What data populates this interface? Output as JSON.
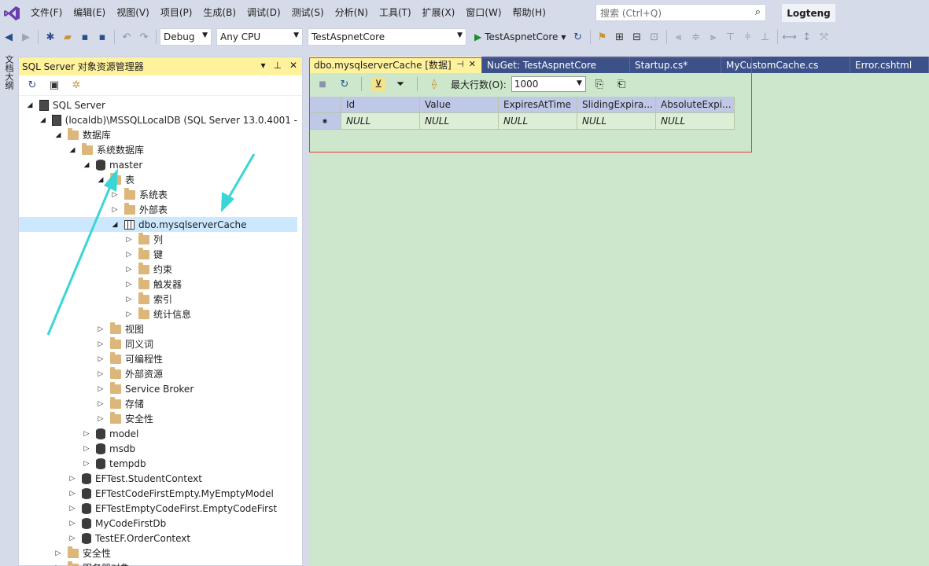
{
  "menu": {
    "items": [
      "文件(F)",
      "编辑(E)",
      "视图(V)",
      "项目(P)",
      "生成(B)",
      "调试(D)",
      "测试(S)",
      "分析(N)",
      "工具(T)",
      "扩展(X)",
      "窗口(W)",
      "帮助(H)"
    ],
    "search_placeholder": "搜索 (Ctrl+Q)",
    "user_name": "Logteng"
  },
  "toolbar": {
    "config": "Debug",
    "platform": "Any CPU",
    "project": "TestAspnetCore",
    "run_target": "TestAspnetCore"
  },
  "left_strip_label": "文档大纲",
  "object_explorer": {
    "title": "SQL Server 对象资源管理器",
    "tree": [
      {
        "label": "SQL Server",
        "depth": 0,
        "icon": "server-icon",
        "expanded": true
      },
      {
        "label": "(localdb)\\MSSQLLocalDB (SQL Server 13.0.4001 -",
        "depth": 1,
        "icon": "server-icon",
        "expanded": true
      },
      {
        "label": "数据库",
        "depth": 2,
        "icon": "folder-icon",
        "expanded": true
      },
      {
        "label": "系统数据库",
        "depth": 3,
        "icon": "folder-icon",
        "expanded": true
      },
      {
        "label": "master",
        "depth": 4,
        "icon": "database-icon",
        "expanded": true
      },
      {
        "label": "表",
        "depth": 5,
        "icon": "folder-icon",
        "expanded": true
      },
      {
        "label": "系统表",
        "depth": 6,
        "icon": "folder-icon",
        "expanded": false
      },
      {
        "label": "外部表",
        "depth": 6,
        "icon": "folder-icon",
        "expanded": false
      },
      {
        "label": "dbo.mysqlserverCache",
        "depth": 6,
        "icon": "table-icon",
        "expanded": true,
        "selected": true
      },
      {
        "label": "列",
        "depth": 7,
        "icon": "folder-icon",
        "expanded": false
      },
      {
        "label": "键",
        "depth": 7,
        "icon": "folder-icon",
        "expanded": false
      },
      {
        "label": "约束",
        "depth": 7,
        "icon": "folder-icon",
        "expanded": false
      },
      {
        "label": "触发器",
        "depth": 7,
        "icon": "folder-icon",
        "expanded": false
      },
      {
        "label": "索引",
        "depth": 7,
        "icon": "folder-icon",
        "expanded": false
      },
      {
        "label": "统计信息",
        "depth": 7,
        "icon": "folder-icon",
        "expanded": false
      },
      {
        "label": "视图",
        "depth": 5,
        "icon": "folder-icon",
        "expanded": false
      },
      {
        "label": "同义词",
        "depth": 5,
        "icon": "folder-icon",
        "expanded": false
      },
      {
        "label": "可编程性",
        "depth": 5,
        "icon": "folder-icon",
        "expanded": false
      },
      {
        "label": "外部资源",
        "depth": 5,
        "icon": "folder-icon",
        "expanded": false
      },
      {
        "label": "Service Broker",
        "depth": 5,
        "icon": "folder-icon",
        "expanded": false
      },
      {
        "label": "存储",
        "depth": 5,
        "icon": "folder-icon",
        "expanded": false
      },
      {
        "label": "安全性",
        "depth": 5,
        "icon": "folder-icon",
        "expanded": false
      },
      {
        "label": "model",
        "depth": 4,
        "icon": "database-icon",
        "expanded": false
      },
      {
        "label": "msdb",
        "depth": 4,
        "icon": "database-icon",
        "expanded": false
      },
      {
        "label": "tempdb",
        "depth": 4,
        "icon": "database-icon",
        "expanded": false
      },
      {
        "label": "EFTest.StudentContext",
        "depth": 3,
        "icon": "database-icon",
        "expanded": false
      },
      {
        "label": "EFTestCodeFirstEmpty.MyEmptyModel",
        "depth": 3,
        "icon": "database-icon",
        "expanded": false
      },
      {
        "label": "EFTestEmptyCodeFirst.EmptyCodeFirst",
        "depth": 3,
        "icon": "database-icon",
        "expanded": false
      },
      {
        "label": "MyCodeFirstDb",
        "depth": 3,
        "icon": "database-icon",
        "expanded": false
      },
      {
        "label": "TestEF.OrderContext",
        "depth": 3,
        "icon": "database-icon",
        "expanded": false
      },
      {
        "label": "安全性",
        "depth": 2,
        "icon": "folder-icon",
        "expanded": false
      },
      {
        "label": "服务器对象",
        "depth": 2,
        "icon": "folder-icon",
        "expanded": false
      }
    ]
  },
  "tabs": [
    {
      "label": "dbo.mysqlserverCache [数据]",
      "active": true
    },
    {
      "label": "NuGet: TestAspnetCore",
      "active": false
    },
    {
      "label": "Startup.cs*",
      "active": false
    },
    {
      "label": "MyCustomCache.cs",
      "active": false
    },
    {
      "label": "Error.cshtml",
      "active": false
    }
  ],
  "data_toolbar": {
    "max_rows_label": "最大行数(O):",
    "max_rows_value": "1000"
  },
  "grid": {
    "columns": [
      "Id",
      "Value",
      "ExpiresAtTime",
      "SlidingExpira...",
      "AbsoluteExpi..."
    ],
    "rows": [
      [
        "NULL",
        "NULL",
        "NULL",
        "NULL",
        "NULL"
      ]
    ]
  },
  "colors": {
    "chrome": "#d6dbe9",
    "active_tab": "#fff29d",
    "tab_bar": "#3d5189",
    "doc_bg": "#cce7cb",
    "highlight": "#e23b3b",
    "arrow": "#3ad6d6"
  }
}
